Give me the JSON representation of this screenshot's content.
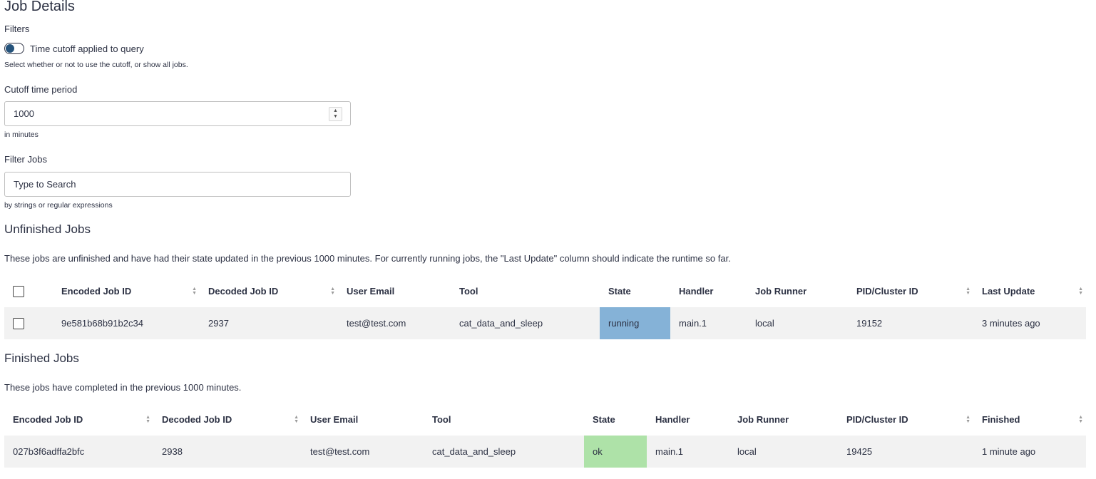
{
  "page": {
    "title": "Job Details"
  },
  "filters": {
    "heading": "Filters",
    "cutoff_toggle_label": "Time cutoff applied to query",
    "cutoff_toggle_help": "Select whether or not to use the cutoff, or show all jobs.",
    "cutoff_toggle_on": false,
    "cutoff_label": "Cutoff time period",
    "cutoff_value": "1000",
    "cutoff_help": "in minutes",
    "filter_label": "Filter Jobs",
    "filter_placeholder": "Type to Search",
    "filter_help": "by strings or regular expressions"
  },
  "unfinished": {
    "heading": "Unfinished Jobs",
    "description": "These jobs are unfinished and have had their state updated in the previous 1000 minutes. For currently running jobs, the \"Last Update\" column should indicate the runtime so far.",
    "columns": [
      "Encoded Job ID",
      "Decoded Job ID",
      "User Email",
      "Tool",
      "State",
      "Handler",
      "Job Runner",
      "PID/Cluster ID",
      "Last Update"
    ],
    "rows": [
      {
        "encoded_id": "9e581b68b91b2c34",
        "decoded_id": "2937",
        "email": "test@test.com",
        "tool": "cat_data_and_sleep",
        "state": "running",
        "state_color": "#85b2d7",
        "handler": "main.1",
        "runner": "local",
        "pid": "19152",
        "last_update": "3 minutes ago"
      }
    ]
  },
  "finished": {
    "heading": "Finished Jobs",
    "description": "These jobs have completed in the previous 1000 minutes.",
    "columns": [
      "Encoded Job ID",
      "Decoded Job ID",
      "User Email",
      "Tool",
      "State",
      "Handler",
      "Job Runner",
      "PID/Cluster ID",
      "Finished"
    ],
    "rows": [
      {
        "encoded_id": "027b3f6adffa2bfc",
        "decoded_id": "2938",
        "email": "test@test.com",
        "tool": "cat_data_and_sleep",
        "state": "ok",
        "state_color": "#aee2a8",
        "handler": "main.1",
        "runner": "local",
        "pid": "19425",
        "finished": "1 minute ago"
      }
    ]
  }
}
